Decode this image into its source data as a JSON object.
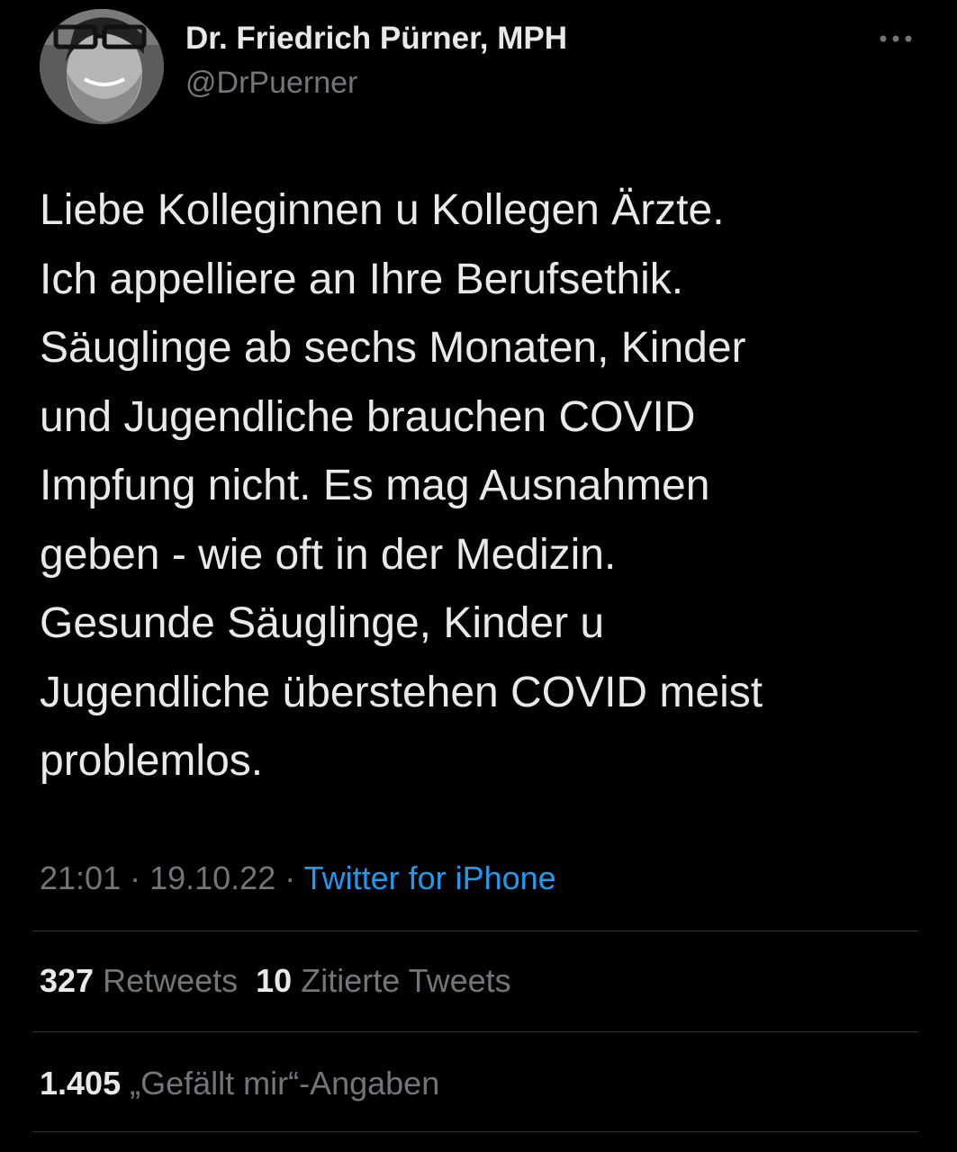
{
  "author": {
    "display_name": "Dr. Friedrich Pürner, MPH",
    "handle": "@DrPuerner",
    "avatar_icon": "profile-photo-bearded-man-glasses"
  },
  "header": {
    "more_icon": "more-horizontal-icon"
  },
  "tweet": {
    "lines": [
      "Liebe Kolleginnen u Kollegen Ärzte.",
      "Ich appelliere an Ihre Berufsethik.",
      "Säuglinge ab sechs Monaten, Kinder",
      "und Jugendliche brauchen COVID",
      "Impfung nicht. Es mag Ausnahmen",
      "geben - wie oft in der Medizin.",
      "Gesunde Säuglinge, Kinder u",
      "Jugendliche überstehen COVID meist",
      "problemlos."
    ]
  },
  "meta": {
    "time": "21:01",
    "separator": " · ",
    "date": "19.10.22",
    "source": "Twitter for iPhone"
  },
  "stats": {
    "retweets_count": "327",
    "retweets_label": " Retweets",
    "quotes_count": "10",
    "quotes_label": " Zitierte Tweets",
    "likes_count": "1.405",
    "likes_label": " „Gefällt mir“-Angaben"
  },
  "colors": {
    "background": "#000000",
    "primary_text": "#e7e9ea",
    "secondary_text": "#71767b",
    "link": "#1d9bf0",
    "divider": "#2f3336"
  }
}
